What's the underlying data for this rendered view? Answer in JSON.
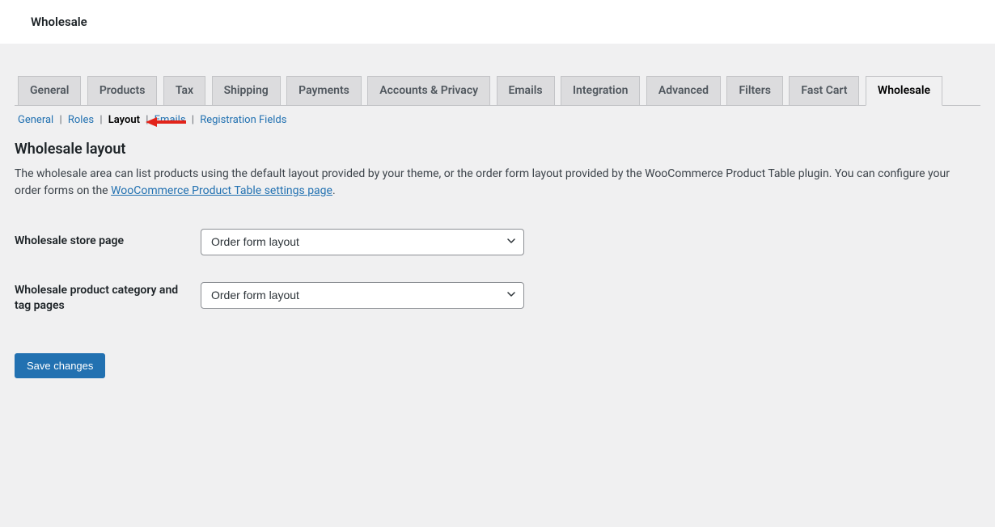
{
  "topbar": {
    "title": "Wholesale"
  },
  "tabs": [
    {
      "label": "General",
      "active": false
    },
    {
      "label": "Products",
      "active": false
    },
    {
      "label": "Tax",
      "active": false
    },
    {
      "label": "Shipping",
      "active": false
    },
    {
      "label": "Payments",
      "active": false
    },
    {
      "label": "Accounts & Privacy",
      "active": false
    },
    {
      "label": "Emails",
      "active": false
    },
    {
      "label": "Integration",
      "active": false
    },
    {
      "label": "Advanced",
      "active": false
    },
    {
      "label": "Filters",
      "active": false
    },
    {
      "label": "Fast Cart",
      "active": false
    },
    {
      "label": "Wholesale",
      "active": true
    }
  ],
  "subtabs": [
    {
      "label": "General",
      "current": false
    },
    {
      "label": "Roles",
      "current": false
    },
    {
      "label": "Layout",
      "current": true
    },
    {
      "label": "Emails",
      "current": false
    },
    {
      "label": "Registration Fields",
      "current": false
    }
  ],
  "section": {
    "title": "Wholesale layout",
    "desc_pre": "The wholesale area can list products using the default layout provided by your theme, or the order form layout provided by the WooCommerce Product Table plugin. You can configure your order forms on the ",
    "desc_link": "WooCommerce Product Table settings page",
    "desc_post": "."
  },
  "fields": {
    "store_page": {
      "label": "Wholesale store page",
      "value": "Order form layout"
    },
    "category_tag": {
      "label": "Wholesale product category and tag pages",
      "value": "Order form layout"
    }
  },
  "buttons": {
    "save": "Save changes"
  }
}
